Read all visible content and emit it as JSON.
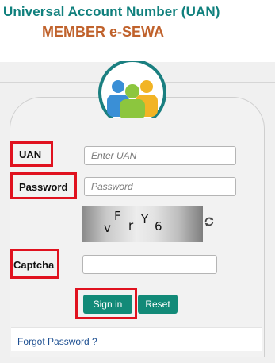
{
  "header": {
    "title": "Universal Account Number (UAN)",
    "subtitle": "MEMBER e-SEWA"
  },
  "form": {
    "uan": {
      "label": "UAN",
      "placeholder": "Enter UAN",
      "value": ""
    },
    "password": {
      "label": "Password",
      "placeholder": "Password",
      "value": ""
    },
    "captcha": {
      "label": "Captcha",
      "value": "",
      "image_chars": [
        "v",
        "F",
        "r",
        "Y",
        "6"
      ]
    },
    "sign_in_label": "Sign in",
    "reset_label": "Reset",
    "forgot_password_label": "Forgot Password ?"
  },
  "icons": {
    "logo": "people-group-icon",
    "refresh": "refresh-icon"
  },
  "colors": {
    "brand_teal": "#10807d",
    "subtitle_orange": "#c0622c",
    "button_teal": "#128a78",
    "highlight_red": "#e0121f",
    "link_blue": "#1d4f91"
  }
}
